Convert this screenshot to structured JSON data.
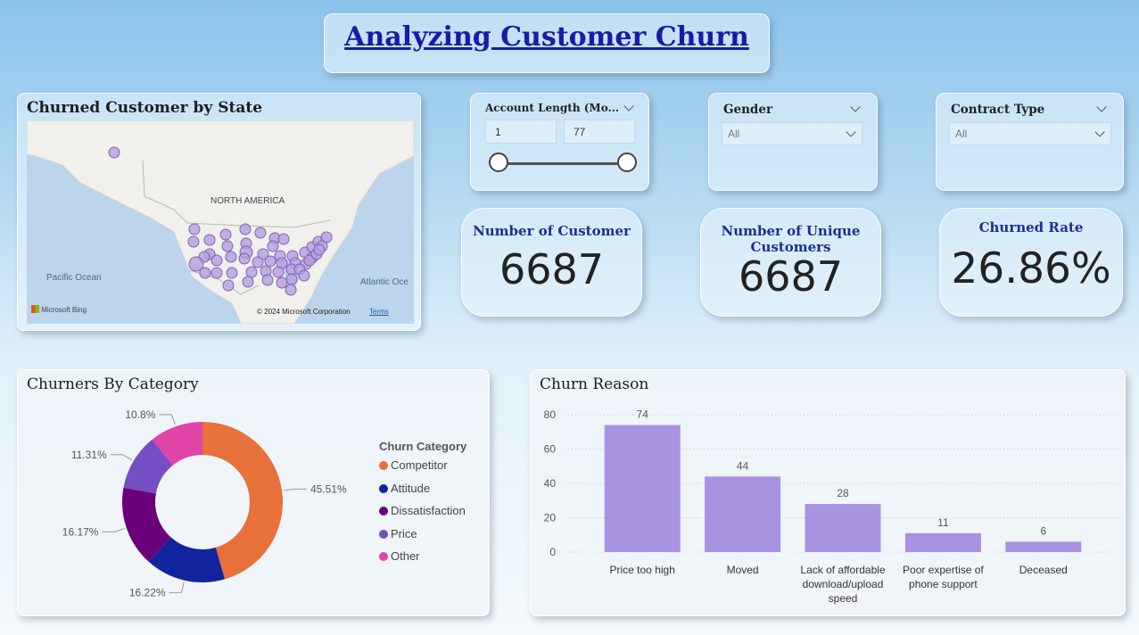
{
  "page_title": "Analyzing Customer Churn",
  "map_card": {
    "title": "Churned Customer by State",
    "labels": {
      "region": "NORTH AMERICA",
      "pacific": "Pacific Ocean",
      "atlantic": "Atlantic Oce"
    },
    "attribution": "Microsoft Bing",
    "copyright": "© 2024 Microsoft Corporation",
    "terms": "Terms"
  },
  "slicers": {
    "account_length": {
      "title": "Account Length (Mo...",
      "min": "1",
      "max": "77"
    },
    "gender": {
      "title": "Gender",
      "value": "All"
    },
    "contract": {
      "title": "Contract Type",
      "value": "All"
    }
  },
  "kpis": {
    "customers": {
      "title": "Number of Customer",
      "value": "6687"
    },
    "unique": {
      "title_line1": "Number of  Unique",
      "title_line2": "Customers",
      "value": "6687"
    },
    "churn_rate": {
      "title": "Churned Rate",
      "value": "26.86%"
    }
  },
  "category_card": {
    "title": "Churners By Category",
    "legend_title": "Churn Category"
  },
  "reason_card": {
    "title": "Churn Reason"
  },
  "colors": {
    "competitor": "#e8703a",
    "attitude": "#12239e",
    "dissatisfaction": "#6b007b",
    "price": "#744ec2",
    "other": "#e044a7",
    "bar": "#a993e0",
    "map_dot": "#b79de0"
  },
  "chart_data": [
    {
      "type": "pie",
      "title": "Churners By Category",
      "legend_title": "Churn Category",
      "slices": [
        {
          "name": "Competitor",
          "value": 45.51,
          "label": "45.51%"
        },
        {
          "name": "Attitude",
          "value": 16.22,
          "label": "16.22%"
        },
        {
          "name": "Dissatisfaction",
          "value": 16.17,
          "label": "16.17%"
        },
        {
          "name": "Price",
          "value": 11.31,
          "label": "11.31%"
        },
        {
          "name": "Other",
          "value": 10.8,
          "label": "10.8%"
        }
      ]
    },
    {
      "type": "bar",
      "title": "Churn Reason",
      "categories": [
        "Price too high",
        "Moved",
        "Lack of affordable download/upload speed",
        "Poor expertise of phone support",
        "Deceased"
      ],
      "category_lines": [
        [
          "Price too high"
        ],
        [
          "Moved"
        ],
        [
          "Lack of affordable",
          "download/upload",
          "speed"
        ],
        [
          "Poor expertise of",
          "phone support"
        ],
        [
          "Deceased"
        ]
      ],
      "values": [
        74,
        44,
        28,
        11,
        6
      ],
      "ylim": [
        0,
        80
      ],
      "yticks": [
        "0",
        "20",
        "40",
        "60",
        "80"
      ],
      "grid": true
    }
  ]
}
